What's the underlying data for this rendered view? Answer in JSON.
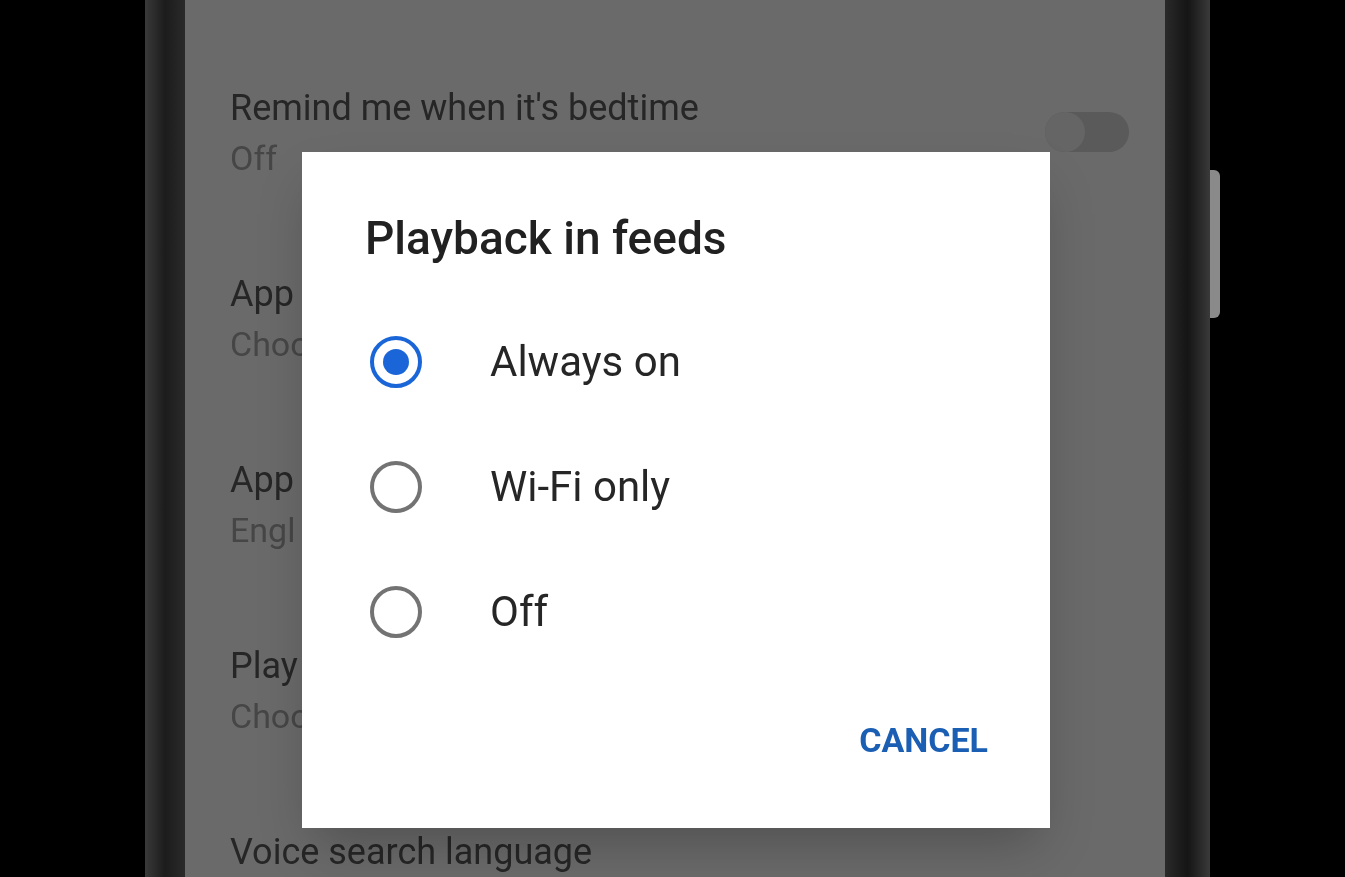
{
  "background_settings": [
    {
      "title": "Remind me when it's bedtime",
      "subtitle": "Off",
      "toggle": {
        "on": false
      }
    },
    {
      "title": "App",
      "subtitle": "Choo"
    },
    {
      "title": "App",
      "subtitle": "Engl"
    },
    {
      "title": "Play",
      "subtitle": "Choo"
    },
    {
      "title": "Voice search language"
    }
  ],
  "dialog": {
    "title": "Playback in feeds",
    "options": [
      {
        "label": "Always on",
        "selected": true
      },
      {
        "label": "Wi-Fi only",
        "selected": false
      },
      {
        "label": "Off",
        "selected": false
      }
    ],
    "buttons": [
      {
        "label": "CANCEL"
      }
    ]
  }
}
